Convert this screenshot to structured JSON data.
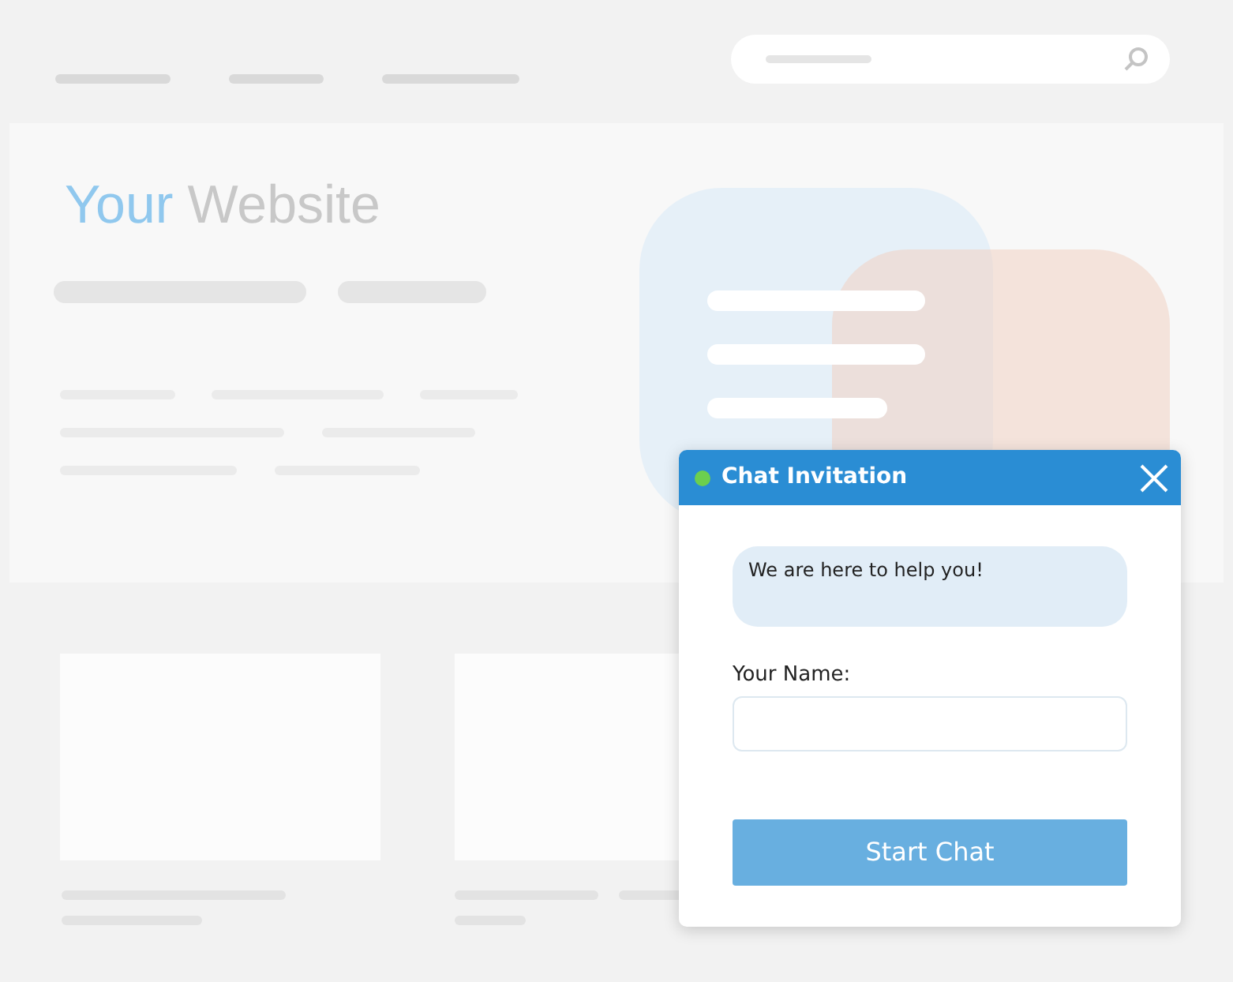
{
  "logo": {
    "parts": [
      {
        "text": "Your",
        "kind": "accent"
      },
      {
        "text": "Website",
        "kind": "plain"
      }
    ]
  },
  "chat": {
    "title": "Chat Invitation",
    "online": true,
    "message": "We are here to help you!",
    "name_label": "Your Name:",
    "start_button": "Start Chat"
  }
}
